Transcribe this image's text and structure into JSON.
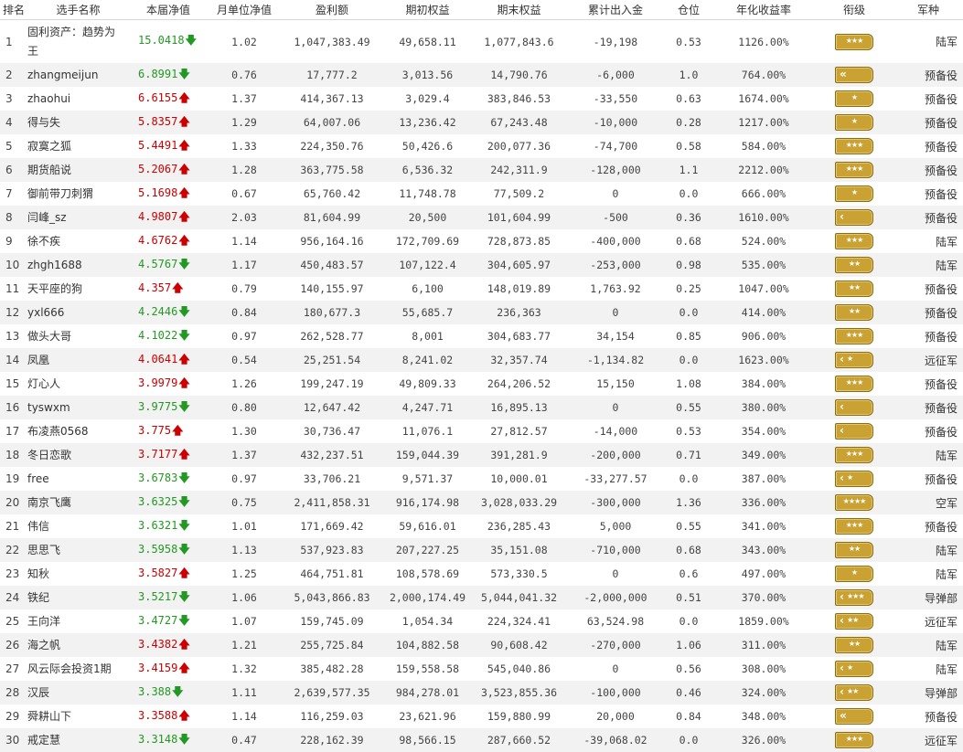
{
  "headers": [
    "排名",
    "选手名称",
    "本届净值",
    "月单位净值",
    "盈利额",
    "期初权益",
    "期末权益",
    "累计出入金",
    "仓位",
    "年化收益率",
    "衔级",
    "军种"
  ],
  "arrows": {
    "up": "🡅",
    "down": "🡇"
  },
  "rows": [
    {
      "rank": "1",
      "name": "固利资产：趋势为王",
      "nav": "15.0418",
      "dir": "down",
      "monthly": "1.02",
      "profit": "1,047,383.49",
      "start": "49,658.11",
      "end": "1,077,843.6",
      "flow": "-19,198",
      "position": "0.53",
      "annual": "1126.00%",
      "stars": "★★★",
      "chev": "",
      "army": "陆军"
    },
    {
      "rank": "2",
      "name": "zhangmeijun",
      "nav": "6.8991",
      "dir": "down",
      "monthly": "0.76",
      "profit": "17,777.2",
      "start": "3,013.56",
      "end": "14,790.76",
      "flow": "-6,000",
      "position": "1.0",
      "annual": "764.00%",
      "stars": "",
      "chev": "«",
      "army": "预备役"
    },
    {
      "rank": "3",
      "name": "zhaohui",
      "nav": "6.6155",
      "dir": "up",
      "monthly": "1.37",
      "profit": "414,367.13",
      "start": "3,029.4",
      "end": "383,846.53",
      "flow": "-33,550",
      "position": "0.63",
      "annual": "1674.00%",
      "stars": "★",
      "chev": "",
      "army": "预备役"
    },
    {
      "rank": "4",
      "name": "得与失",
      "nav": "5.8357",
      "dir": "up",
      "monthly": "1.29",
      "profit": "64,007.06",
      "start": "13,236.42",
      "end": "67,243.48",
      "flow": "-10,000",
      "position": "0.28",
      "annual": "1217.00%",
      "stars": "★",
      "chev": "",
      "army": "预备役"
    },
    {
      "rank": "5",
      "name": "寂寞之狐",
      "nav": "5.4491",
      "dir": "up",
      "monthly": "1.33",
      "profit": "224,350.76",
      "start": "50,426.6",
      "end": "200,077.36",
      "flow": "-74,700",
      "position": "0.58",
      "annual": "584.00%",
      "stars": "★★★",
      "chev": "",
      "army": "预备役"
    },
    {
      "rank": "6",
      "name": "期货船说",
      "nav": "5.2067",
      "dir": "up",
      "monthly": "1.28",
      "profit": "363,775.58",
      "start": "6,536.32",
      "end": "242,311.9",
      "flow": "-128,000",
      "position": "1.1",
      "annual": "2212.00%",
      "stars": "★★★",
      "chev": "",
      "army": "预备役"
    },
    {
      "rank": "7",
      "name": "御前带刀刺猬",
      "nav": "5.1698",
      "dir": "up",
      "monthly": "0.67",
      "profit": "65,760.42",
      "start": "11,748.78",
      "end": "77,509.2",
      "flow": "0",
      "position": "0.0",
      "annual": "666.00%",
      "stars": "★",
      "chev": "",
      "army": "预备役"
    },
    {
      "rank": "8",
      "name": "闫峰_sz",
      "nav": "4.9807",
      "dir": "up",
      "monthly": "2.03",
      "profit": "81,604.99",
      "start": "20,500",
      "end": "101,604.99",
      "flow": "-500",
      "position": "0.36",
      "annual": "1610.00%",
      "stars": "",
      "chev": "‹",
      "army": "预备役"
    },
    {
      "rank": "9",
      "name": "徐不疾",
      "nav": "4.6762",
      "dir": "up",
      "monthly": "1.14",
      "profit": "956,164.16",
      "start": "172,709.69",
      "end": "728,873.85",
      "flow": "-400,000",
      "position": "0.68",
      "annual": "524.00%",
      "stars": "★★★",
      "chev": "",
      "army": "陆军"
    },
    {
      "rank": "10",
      "name": "zhgh1688",
      "nav": "4.5767",
      "dir": "down",
      "monthly": "1.17",
      "profit": "450,483.57",
      "start": "107,122.4",
      "end": "304,605.97",
      "flow": "-253,000",
      "position": "0.98",
      "annual": "535.00%",
      "stars": "★★",
      "chev": "",
      "army": "陆军"
    },
    {
      "rank": "11",
      "name": "天平座的狗",
      "nav": "4.357",
      "dir": "up",
      "monthly": "0.79",
      "profit": "140,155.97",
      "start": "6,100",
      "end": "148,019.89",
      "flow": "1,763.92",
      "position": "0.25",
      "annual": "1047.00%",
      "stars": "★★",
      "chev": "",
      "army": "预备役"
    },
    {
      "rank": "12",
      "name": "yxl666",
      "nav": "4.2446",
      "dir": "down",
      "monthly": "0.84",
      "profit": "180,677.3",
      "start": "55,685.7",
      "end": "236,363",
      "flow": "0",
      "position": "0.0",
      "annual": "414.00%",
      "stars": "★★",
      "chev": "",
      "army": "预备役"
    },
    {
      "rank": "13",
      "name": "做头大哥",
      "nav": "4.1022",
      "dir": "down",
      "monthly": "0.97",
      "profit": "262,528.77",
      "start": "8,001",
      "end": "304,683.77",
      "flow": "34,154",
      "position": "0.85",
      "annual": "906.00%",
      "stars": "★★★",
      "chev": "",
      "army": "预备役"
    },
    {
      "rank": "14",
      "name": "凤凰",
      "nav": "4.0641",
      "dir": "up",
      "monthly": "0.54",
      "profit": "25,251.54",
      "start": "8,241.02",
      "end": "32,357.74",
      "flow": "-1,134.82",
      "position": "0.0",
      "annual": "1623.00%",
      "stars": "★",
      "chev": "‹",
      "army": "远征军"
    },
    {
      "rank": "15",
      "name": "灯心人",
      "nav": "3.9979",
      "dir": "up",
      "monthly": "1.26",
      "profit": "199,247.19",
      "start": "49,809.33",
      "end": "264,206.52",
      "flow": "15,150",
      "position": "1.08",
      "annual": "384.00%",
      "stars": "★★★",
      "chev": "",
      "army": "预备役"
    },
    {
      "rank": "16",
      "name": "tyswxm",
      "nav": "3.9775",
      "dir": "down",
      "monthly": "0.80",
      "profit": "12,647.42",
      "start": "4,247.71",
      "end": "16,895.13",
      "flow": "0",
      "position": "0.55",
      "annual": "380.00%",
      "stars": "",
      "chev": "‹",
      "army": "预备役"
    },
    {
      "rank": "17",
      "name": "布凌燕0568",
      "nav": "3.775",
      "dir": "up",
      "monthly": "1.30",
      "profit": "30,736.47",
      "start": "11,076.1",
      "end": "27,812.57",
      "flow": "-14,000",
      "position": "0.53",
      "annual": "354.00%",
      "stars": "",
      "chev": "‹",
      "army": "预备役"
    },
    {
      "rank": "18",
      "name": "冬日恋歌",
      "nav": "3.7177",
      "dir": "up",
      "monthly": "1.37",
      "profit": "432,237.51",
      "start": "159,044.39",
      "end": "391,281.9",
      "flow": "-200,000",
      "position": "0.71",
      "annual": "349.00%",
      "stars": "★★★",
      "chev": "",
      "army": "陆军"
    },
    {
      "rank": "19",
      "name": "free",
      "nav": "3.6783",
      "dir": "down",
      "monthly": "0.97",
      "profit": "33,706.21",
      "start": "9,571.37",
      "end": "10,000.01",
      "flow": "-33,277.57",
      "position": "0.0",
      "annual": "387.00%",
      "stars": "★",
      "chev": "‹",
      "army": "预备役"
    },
    {
      "rank": "20",
      "name": "南京飞鹰",
      "nav": "3.6325",
      "dir": "down",
      "monthly": "0.75",
      "profit": "2,411,858.31",
      "start": "916,174.98",
      "end": "3,028,033.29",
      "flow": "-300,000",
      "position": "1.36",
      "annual": "336.00%",
      "stars": "★★★★",
      "chev": "",
      "army": "空军"
    },
    {
      "rank": "21",
      "name": "伟信",
      "nav": "3.6321",
      "dir": "down",
      "monthly": "1.01",
      "profit": "171,669.42",
      "start": "59,616.01",
      "end": "236,285.43",
      "flow": "5,000",
      "position": "0.55",
      "annual": "341.00%",
      "stars": "★★★",
      "chev": "",
      "army": "预备役"
    },
    {
      "rank": "22",
      "name": "思思飞",
      "nav": "3.5958",
      "dir": "down",
      "monthly": "1.13",
      "profit": "537,923.83",
      "start": "207,227.25",
      "end": "35,151.08",
      "flow": "-710,000",
      "position": "0.68",
      "annual": "343.00%",
      "stars": "★★",
      "chev": "",
      "army": "陆军"
    },
    {
      "rank": "23",
      "name": "知秋",
      "nav": "3.5827",
      "dir": "up",
      "monthly": "1.25",
      "profit": "464,751.81",
      "start": "108,578.69",
      "end": "573,330.5",
      "flow": "0",
      "position": "0.6",
      "annual": "497.00%",
      "stars": "★",
      "chev": "",
      "army": "陆军"
    },
    {
      "rank": "24",
      "name": "铁纪",
      "nav": "3.5217",
      "dir": "down",
      "monthly": "1.06",
      "profit": "5,043,866.83",
      "start": "2,000,174.49",
      "end": "5,044,041.32",
      "flow": "-2,000,000",
      "position": "0.51",
      "annual": "370.00%",
      "stars": "★★★",
      "chev": "‹",
      "army": "导弹部"
    },
    {
      "rank": "25",
      "name": "王向洋",
      "nav": "3.4727",
      "dir": "down",
      "monthly": "1.07",
      "profit": "159,745.09",
      "start": "1,054.34",
      "end": "224,324.41",
      "flow": "63,524.98",
      "position": "0.0",
      "annual": "1859.00%",
      "stars": "★★",
      "chev": "‹",
      "army": "远征军"
    },
    {
      "rank": "26",
      "name": "海之帆",
      "nav": "3.4382",
      "dir": "up",
      "monthly": "1.21",
      "profit": "255,725.84",
      "start": "104,882.58",
      "end": "90,608.42",
      "flow": "-270,000",
      "position": "1.06",
      "annual": "311.00%",
      "stars": "★★",
      "chev": "",
      "army": "陆军"
    },
    {
      "rank": "27",
      "name": "风云际会投资1期",
      "nav": "3.4159",
      "dir": "up",
      "monthly": "1.32",
      "profit": "385,482.28",
      "start": "159,558.58",
      "end": "545,040.86",
      "flow": "0",
      "position": "0.56",
      "annual": "308.00%",
      "stars": "★",
      "chev": "‹",
      "army": "陆军"
    },
    {
      "rank": "28",
      "name": "汉辰",
      "nav": "3.388",
      "dir": "down",
      "monthly": "1.11",
      "profit": "2,639,577.35",
      "start": "984,278.01",
      "end": "3,523,855.36",
      "flow": "-100,000",
      "position": "0.46",
      "annual": "324.00%",
      "stars": "★★",
      "chev": "‹",
      "army": "导弹部"
    },
    {
      "rank": "29",
      "name": "舜耕山下",
      "nav": "3.3588",
      "dir": "up",
      "monthly": "1.14",
      "profit": "116,259.03",
      "start": "23,621.96",
      "end": "159,880.99",
      "flow": "20,000",
      "position": "0.84",
      "annual": "348.00%",
      "stars": "",
      "chev": "«",
      "army": "预备役"
    },
    {
      "rank": "30",
      "name": "戒定慧",
      "nav": "3.3148",
      "dir": "down",
      "monthly": "0.47",
      "profit": "228,162.39",
      "start": "98,566.15",
      "end": "287,660.52",
      "flow": "-39,068.02",
      "position": "0.0",
      "annual": "326.00%",
      "stars": "★★★",
      "chev": "",
      "army": "远征军"
    }
  ]
}
